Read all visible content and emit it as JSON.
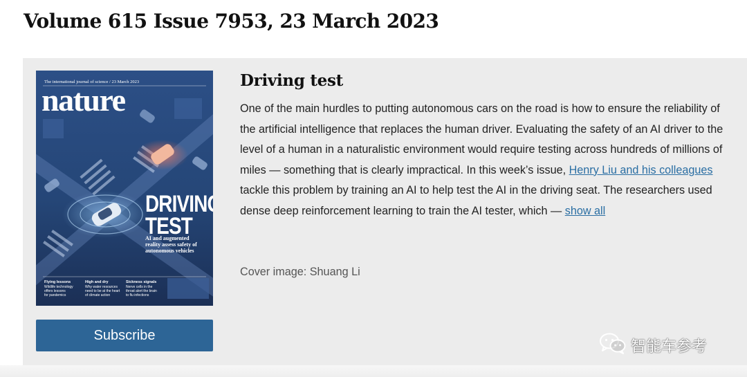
{
  "issue": {
    "heading": "Volume 615 Issue 7953, 23 March 2023"
  },
  "cover": {
    "masthead_top": "The international journal of science / 23 March 2023",
    "logo": "nature",
    "headline_line1": "DRIVING",
    "headline_line2": "TEST",
    "subhead_line1": "AI and augmented",
    "subhead_line2": "reality assess safety of",
    "subhead_line3": "autonomous vehicles",
    "teasers": [
      {
        "title": "Flying lessons",
        "line1": "Wildlife technology",
        "line2": "offers lessons",
        "line3": "for pandemics"
      },
      {
        "title": "High and dry",
        "line1": "Why water resources",
        "line2": "need to be at the heart",
        "line3": "of climate action"
      },
      {
        "title": "Sickness signals",
        "line1": "Nerve cells in the",
        "line2": "throat alert the brain",
        "line3": "to flu infections"
      }
    ]
  },
  "subscribe": {
    "label": "Subscribe"
  },
  "article": {
    "title": "Driving test",
    "body_before_link": "One of the main hurdles to putting autonomous cars on the road is how to ensure the reliability of the artificial intelligence that replaces the human driver. Evaluating the safety of an AI driver to the level of a human in a naturalistic environment would require testing across hundreds of millions of miles — something that is clearly impractical. In this week’s issue, ",
    "link_text": "Henry Liu and his colleagues",
    "body_after_link": " tackle this problem by training an AI to help test the AI in the driving seat. The researchers used dense deep reinforcement learning to train the AI tester, which — ",
    "show_all": "show all",
    "cover_credit": "Cover image: Shuang Li"
  },
  "watermark": {
    "text": "智能车参考",
    "icon": "wechat-icon"
  },
  "colors": {
    "panel_bg": "#ececec",
    "subscribe_bg": "#2d6596",
    "link": "#2a6ea3"
  }
}
